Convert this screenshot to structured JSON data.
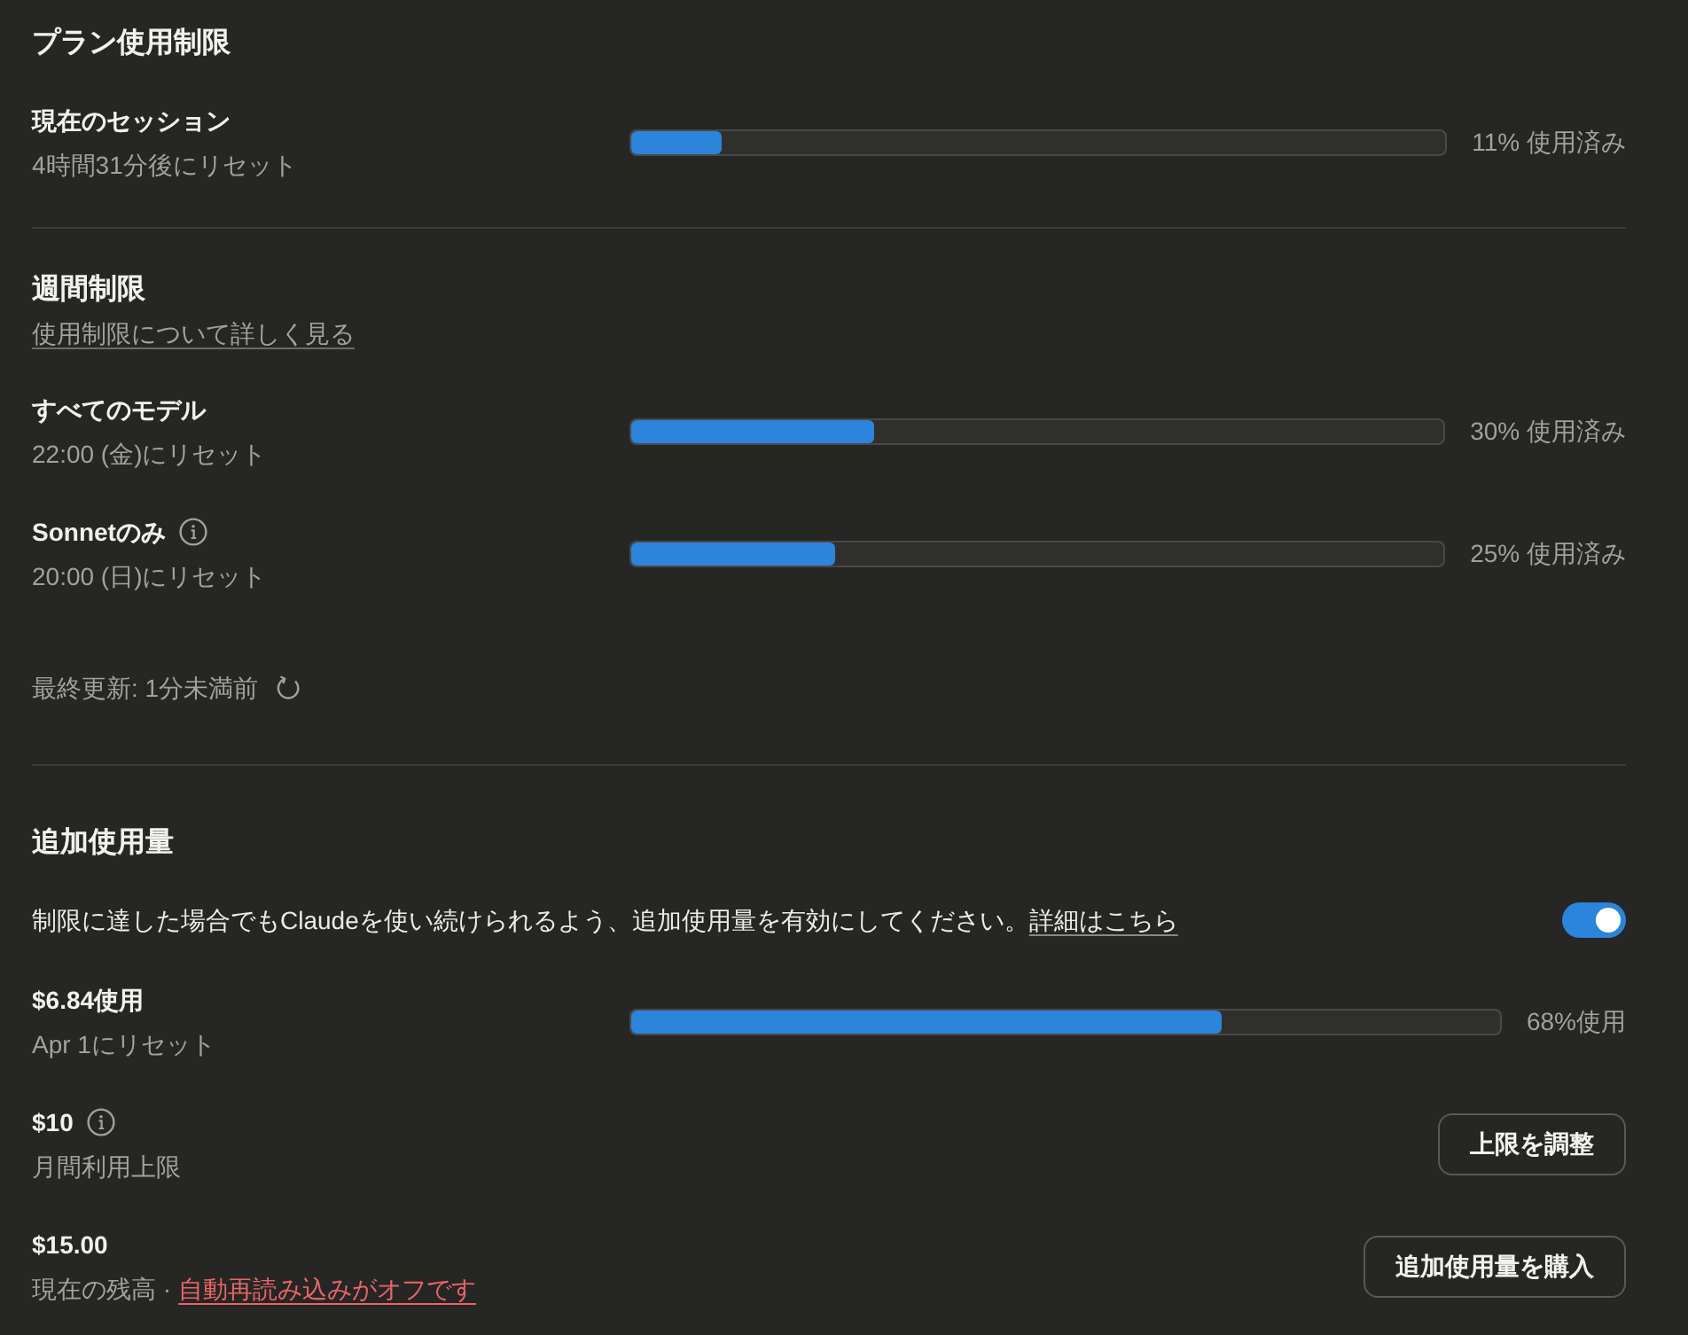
{
  "plan_limits": {
    "title": "プラン使用制限",
    "meters": [
      {
        "name": "現在のセッション",
        "info": false,
        "reset": "4時間31分後にリセット",
        "level": 0.11,
        "reading": "11% 使用済み"
      }
    ]
  },
  "weekly_limits": {
    "title": "週間制限",
    "link": "使用制限について詳しく見る",
    "meters": [
      {
        "name": "すべてのモデル",
        "info": false,
        "reset": "22:00 (金)にリセット",
        "level": 0.3,
        "reading": "30% 使用済み"
      },
      {
        "name": "Sonnetのみ",
        "info": true,
        "reset": "20:00 (日)にリセット",
        "level": 0.25,
        "reading": "25% 使用済み"
      }
    ],
    "last_updated": "最終更新: 1分未満前"
  },
  "extra_usage": {
    "title": "追加使用量",
    "description": "制限に達した場合でもClaudeを使い続けられるよう、追加使用量を有効にしてください。",
    "link": "詳細はこちら",
    "on": true,
    "usage": {
      "amount": "$6.84使用",
      "reset": "Apr 1にリセット",
      "level": 0.68,
      "reading": "68%使用"
    },
    "limit": {
      "amount": "$10",
      "info": true,
      "caption": "月間利用上限",
      "button": "上限を調整"
    },
    "balance": {
      "amount": "$15.00",
      "caption": "現在の残高 ·",
      "auto_reload": "自動再読み込みがオフです",
      "button": "追加使用量を購入"
    }
  }
}
